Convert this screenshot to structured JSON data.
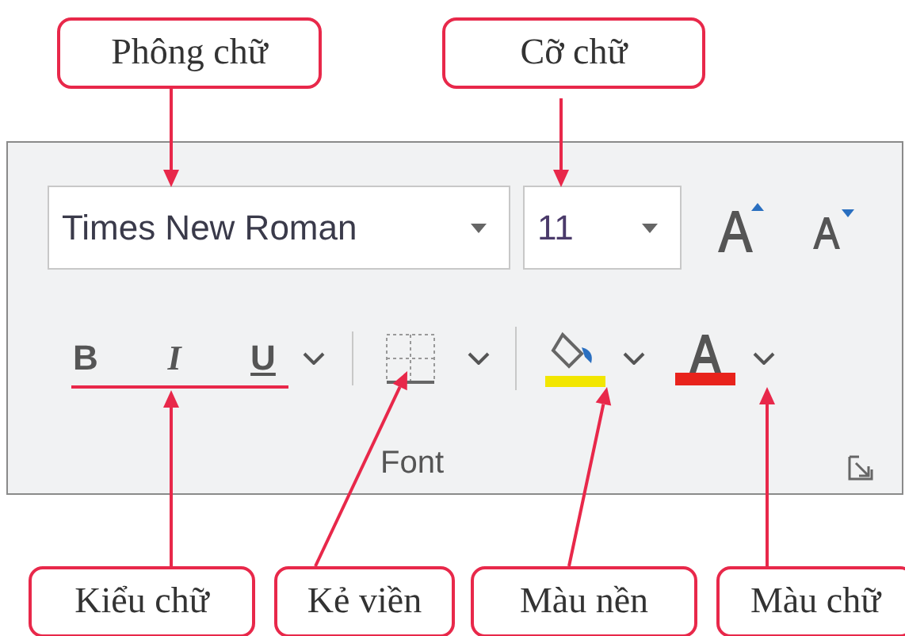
{
  "callouts_top": [
    {
      "text": "Phông chữ"
    },
    {
      "text": "Cỡ chữ"
    }
  ],
  "font_group": {
    "font_name": "Times New Roman",
    "font_size": "11",
    "style_buttons": [
      "B",
      "I",
      "U"
    ],
    "label": "Font"
  },
  "callouts_bottom": [
    {
      "text": "Kiểu chữ"
    },
    {
      "text": "Kẻ viền"
    },
    {
      "text": "Màu nền"
    },
    {
      "text": "Màu chữ"
    }
  ]
}
